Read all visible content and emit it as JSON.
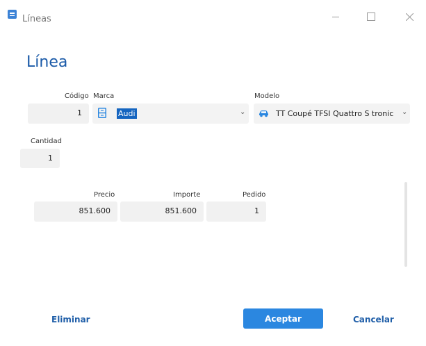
{
  "window": {
    "title": "Líneas",
    "icon": "document-list-icon",
    "controls": [
      "minimize-icon",
      "maximize-icon",
      "close-icon"
    ]
  },
  "page_title": "Línea",
  "fields": {
    "codigo": {
      "label": "Código",
      "value": "1"
    },
    "marca": {
      "label": "Marca",
      "value": "Audi",
      "icon": "brand-icon"
    },
    "modelo": {
      "label": "Modelo",
      "value": "TT Coupé TFSI Quattro S tronic",
      "icon": "car-icon"
    },
    "cantidad": {
      "label": "Cantidad",
      "value": "1"
    },
    "precio": {
      "label": "Precio",
      "value": "851.600"
    },
    "importe": {
      "label": "Importe",
      "value": "851.600"
    },
    "pedido": {
      "label": "Pedido",
      "value": "1"
    }
  },
  "buttons": {
    "eliminar": "Eliminar",
    "aceptar": "Aceptar",
    "cancelar": "Cancelar"
  },
  "colors": {
    "accent": "#2b87e0",
    "title": "#1a5aa8",
    "selection": "#1565c0"
  }
}
